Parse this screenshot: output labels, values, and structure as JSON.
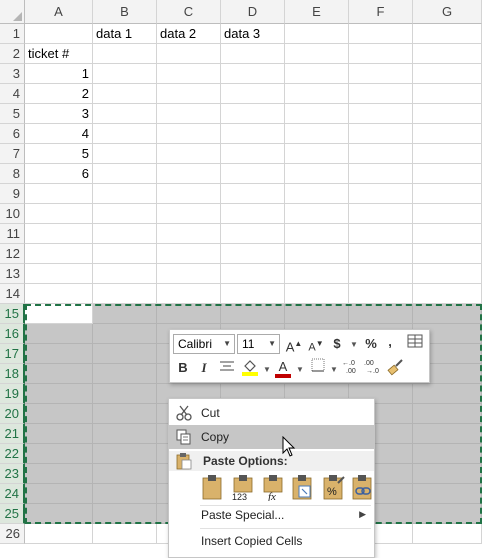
{
  "columns": [
    "A",
    "B",
    "C",
    "D",
    "E",
    "F",
    "G"
  ],
  "row_numbers": [
    "1",
    "2",
    "3",
    "4",
    "5",
    "6",
    "7",
    "8",
    "9",
    "10",
    "11",
    "12",
    "13",
    "14",
    "15",
    "16",
    "17",
    "18",
    "19",
    "20",
    "21",
    "22",
    "23",
    "24",
    "25",
    "26"
  ],
  "cells": {
    "B1": "data 1",
    "C1": "data 2",
    "D1": "data 3",
    "A2": "ticket #",
    "A3": "1",
    "A4": "2",
    "A5": "3",
    "A6": "4",
    "A7": "5",
    "A8": "6"
  },
  "mini_toolbar": {
    "font_name": "Calibri",
    "font_size": "11",
    "grow_font": "A",
    "shrink_font": "A",
    "currency": "$",
    "percent": "%",
    "comma": ",",
    "bold": "B",
    "italic": "I",
    "font_color_letter": "A",
    "highlight_color": "#ffff00",
    "font_color": "#c00000"
  },
  "context_menu": {
    "cut": "Cut",
    "copy": "Copy",
    "paste_options": "Paste Options:",
    "paste_special": "Paste Special...",
    "insert_copied_cells": "Insert Copied Cells"
  },
  "colors": {
    "accent": "#217346",
    "selection_fill": "#c6c6c6"
  }
}
